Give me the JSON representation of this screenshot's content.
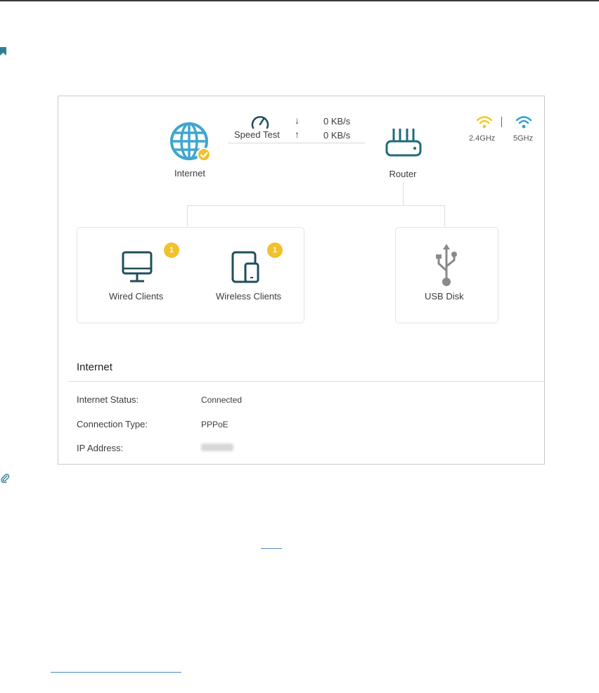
{
  "topology": {
    "internet_label": "Internet",
    "speed_test_label": "Speed Test",
    "download_value": "0 KB/s",
    "upload_value": "0 KB/s",
    "router_label": "Router",
    "wifi_24_label": "2.4GHz",
    "wifi_5_label": "5GHz",
    "wired_clients_label": "Wired Clients",
    "wired_clients_count": "1",
    "wireless_clients_label": "Wireless Clients",
    "wireless_clients_count": "1",
    "usb_disk_label": "USB Disk"
  },
  "internet_section": {
    "heading": "Internet",
    "rows": [
      {
        "key": "Internet Status:",
        "value": "Connected"
      },
      {
        "key": "Connection Type:",
        "value": "PPPoE"
      },
      {
        "key": "IP Address:",
        "value": ""
      }
    ]
  },
  "icons": {
    "internet": "globe-icon",
    "speed_test": "speedometer-icon",
    "router": "router-icon",
    "wifi_24": "wifi-icon",
    "wifi_5": "wifi-icon",
    "wired": "monitor-icon",
    "wireless": "tablet-phone-icon",
    "usb": "usb-icon",
    "connected": "check-icon"
  },
  "colors": {
    "accent_teal": "#1f6c7a",
    "globe_blue": "#3fa6cf",
    "badge_yellow": "#f2c12e",
    "wifi_24_yellow": "#f2c81e",
    "wifi_5_blue": "#2c9fd4",
    "usb_gray": "#8a8a8a"
  }
}
